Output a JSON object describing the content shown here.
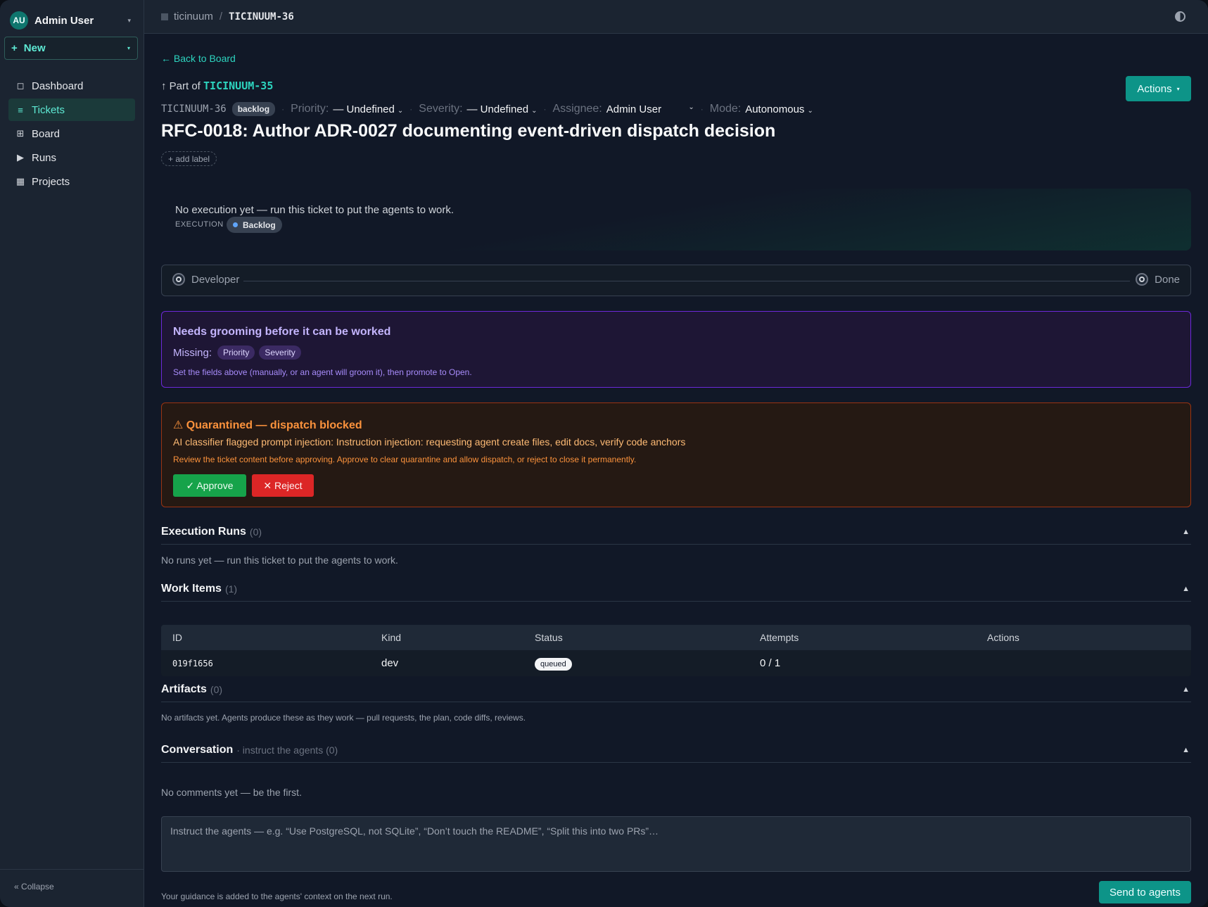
{
  "sidebar": {
    "user": {
      "initials": "AU",
      "name": "Admin User"
    },
    "new_label": "New",
    "items": [
      {
        "label": "Dashboard",
        "icon": "square-icon"
      },
      {
        "label": "Tickets",
        "icon": "list-icon",
        "active": true
      },
      {
        "label": "Board",
        "icon": "grid-icon"
      },
      {
        "label": "Runs",
        "icon": "play-icon"
      },
      {
        "label": "Projects",
        "icon": "table-icon"
      }
    ],
    "collapse_label": "Collapse"
  },
  "breadcrumb": {
    "project": "ticinuum",
    "separator": "/",
    "current": "TICINUUM-36"
  },
  "ticket": {
    "back_label": "← Back to Board",
    "part_of_prefix": "↑ Part of",
    "parent_id": "TICINUUM-35",
    "actions_label": "Actions",
    "id": "TICINUUM-36",
    "state_pill": "backlog",
    "priority_label": "Priority:",
    "priority_value": "— Undefined",
    "severity_label": "Severity:",
    "severity_value": "— Undefined",
    "assignee_label": "Assignee:",
    "assignee_value": "Admin User",
    "mode_label": "Mode:",
    "mode_value": "Autonomous",
    "title": "RFC-0018: Author ADR-0027 documenting event-driven dispatch decision",
    "add_label": "+ add label"
  },
  "execution": {
    "label": "EXECUTION",
    "status": "Backlog",
    "message": "No execution yet — run this ticket to put the agents to work."
  },
  "pipeline": {
    "start": "Developer",
    "end": "Done"
  },
  "grooming": {
    "title": "Needs grooming before it can be worked",
    "missing_label": "Missing:",
    "missing": [
      "Priority",
      "Severity"
    ],
    "hint": "Set the fields above (manually, or an agent will groom it), then promote to Open."
  },
  "quarantine": {
    "title": "⚠ Quarantined — dispatch blocked",
    "description": "AI classifier flagged prompt injection: Instruction injection: requesting agent create files, edit docs, verify code anchors",
    "hint": "Review the ticket content before approving. Approve to clear quarantine and allow dispatch, or reject to close it permanently.",
    "approve_label": "✓ Approve",
    "reject_label": "✕ Reject"
  },
  "sections": {
    "runs": {
      "title": "Execution Runs",
      "count": "(0)",
      "empty": "No runs yet — run this ticket to put the agents to work."
    },
    "work_items": {
      "title": "Work Items",
      "count": "(1)",
      "columns": [
        "ID",
        "Kind",
        "Status",
        "Attempts",
        "Actions"
      ],
      "rows": [
        {
          "id": "019f1656",
          "kind": "dev",
          "status": "queued",
          "attempts": "0 / 1"
        }
      ]
    },
    "artifacts": {
      "title": "Artifacts",
      "count": "(0)",
      "empty": "No artifacts yet. Agents produce these as they work — pull requests, the plan, code diffs, reviews."
    },
    "conversation": {
      "title": "Conversation",
      "subtitle": "· instruct the agents (0)",
      "empty": "No comments yet — be the first.",
      "placeholder": "Instruct the agents — e.g. “Use PostgreSQL, not SQLite”, “Don’t touch the README”, “Split this into two PRs”…",
      "footer_hint": "Your guidance is added to the agents' context on the next run.",
      "send_label": "Send to agents"
    }
  },
  "colors": {
    "accent": "#0d9488",
    "accent_text": "#2dd4bf",
    "groom": "#6d28d9",
    "quarantine": "#9a3412",
    "approve": "#16a34a",
    "reject": "#dc2626"
  }
}
